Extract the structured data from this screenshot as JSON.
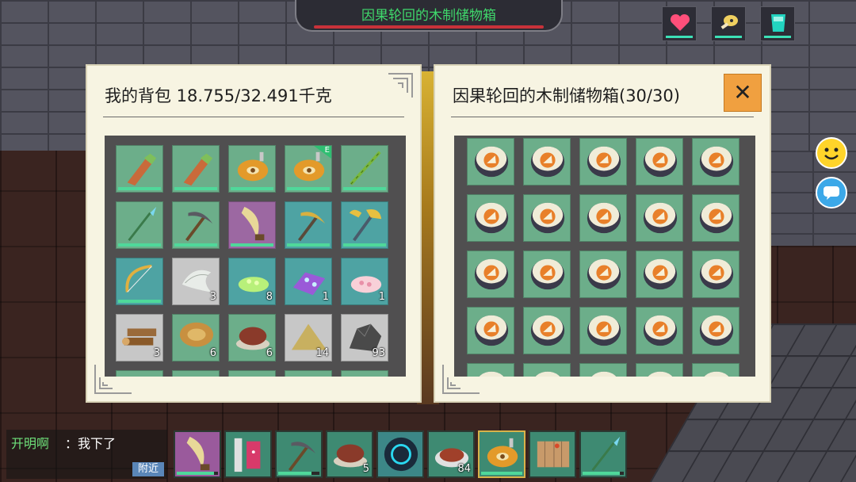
{
  "container": {
    "title": "因果轮回的木制储物箱",
    "health_bar_color": "#c8323a",
    "title_color": "#3fd86b"
  },
  "status": [
    {
      "name": "heart-icon",
      "color": "#ff4f7a"
    },
    {
      "name": "meat-icon",
      "color": "#f0d060"
    },
    {
      "name": "water-cup-icon",
      "color": "#22d4c0"
    }
  ],
  "side_buttons": [
    {
      "name": "emoji-button",
      "icon": "smiley-icon",
      "color": "#ffd42a"
    },
    {
      "name": "chat-toggle-button",
      "icon": "chat-bubble-icon",
      "color": "#3ca8e8"
    }
  ],
  "backpack": {
    "title": "我的背包 18.755/32.491千克",
    "items": [
      {
        "icon": "wooden-club-icon",
        "bg": "green",
        "durability": 1.0
      },
      {
        "icon": "wooden-club-icon",
        "bg": "green",
        "durability": 1.0
      },
      {
        "icon": "water-gourd-icon",
        "bg": "green",
        "durability": 1.0
      },
      {
        "icon": "water-gourd-icon",
        "bg": "green",
        "durability": 1.0,
        "badge": "E"
      },
      {
        "icon": "bamboo-spear-icon",
        "bg": "green",
        "durability": 1.0
      },
      {
        "icon": "crystal-spear-icon",
        "bg": "green",
        "durability": 1.0
      },
      {
        "icon": "pickaxe-icon",
        "bg": "green",
        "durability": 1.0
      },
      {
        "icon": "curved-blade-icon",
        "bg": "purple",
        "durability": 1.0
      },
      {
        "icon": "gold-pickaxe-icon",
        "bg": "teal",
        "durability": 1.0
      },
      {
        "icon": "golden-axe-icon",
        "bg": "teal",
        "durability": 1.0
      },
      {
        "icon": "bow-icon",
        "bg": "teal",
        "durability": 1.0
      },
      {
        "icon": "fiber-bundle-icon",
        "bg": "gray",
        "count": "3"
      },
      {
        "icon": "green-seeds-icon",
        "bg": "teal",
        "count": "8"
      },
      {
        "icon": "purple-crystal-icon",
        "bg": "teal",
        "count": "1"
      },
      {
        "icon": "pink-seeds-icon",
        "bg": "teal",
        "count": "1"
      },
      {
        "icon": "log-icon",
        "bg": "gray",
        "count": "3"
      },
      {
        "icon": "tree-stump-icon",
        "bg": "green",
        "count": "6"
      },
      {
        "icon": "berry-bowl-icon",
        "bg": "green",
        "count": "6"
      },
      {
        "icon": "sand-pile-icon",
        "bg": "gray",
        "count": "14"
      },
      {
        "icon": "stone-ore-icon",
        "bg": "gray",
        "count": "93"
      }
    ]
  },
  "chest": {
    "title": "因果轮回的木制储物箱(30/30)",
    "close_label": "✕",
    "item_icon": "recipe-scroll-icon",
    "visible_rows": 5
  },
  "chat": {
    "name": "开明啊",
    "message": "：我下了",
    "channel": "附近"
  },
  "hotbar": [
    {
      "icon": "curved-blade-icon",
      "bg": "purple",
      "durability": 0.9
    },
    {
      "icon": "pillar-banner-icon",
      "bg": "green"
    },
    {
      "icon": "pickaxe-icon",
      "bg": "green",
      "durability": 0.8
    },
    {
      "icon": "berry-bowl-icon",
      "bg": "green",
      "count": "5"
    },
    {
      "icon": "portal-orb-icon",
      "bg": "teal"
    },
    {
      "icon": "steak-plate-icon",
      "bg": "green",
      "count": "84"
    },
    {
      "icon": "water-gourd-icon",
      "bg": "green",
      "durability": 1.0,
      "selected": true
    },
    {
      "icon": "map-scroll-icon",
      "bg": "green"
    },
    {
      "icon": "crystal-spear-icon",
      "bg": "green",
      "durability": 0.9
    }
  ]
}
